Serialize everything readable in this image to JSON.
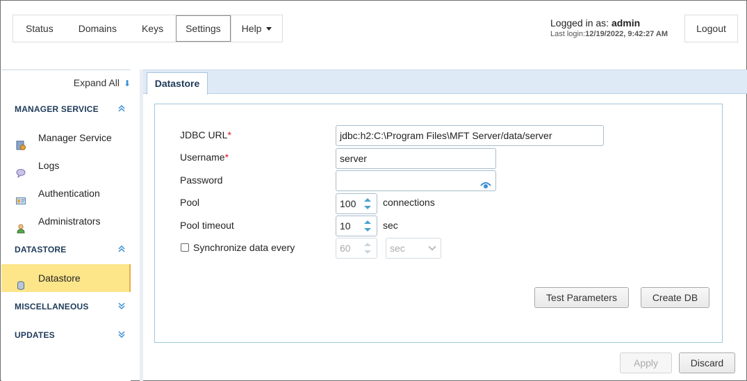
{
  "topnav": {
    "items": [
      "Status",
      "Domains",
      "Keys",
      "Settings",
      "Help"
    ],
    "active": "Settings"
  },
  "login": {
    "prefix": "Logged in as: ",
    "user": "admin",
    "last_prefix": "Last login:",
    "last_value": "12/19/2022, 9:42:27 AM"
  },
  "logout_label": "Logout",
  "sidebar": {
    "expand_all": "Expand All",
    "sections": {
      "manager": "MANAGER SERVICE",
      "datastore": "DATASTORE",
      "misc": "MISCELLANEOUS",
      "updates": "UPDATES"
    },
    "items": {
      "manager_service": "Manager Service",
      "logs": "Logs",
      "authentication": "Authentication",
      "administrators": "Administrators",
      "datastore": "Datastore"
    }
  },
  "tab_label": "Datastore",
  "form": {
    "jdbc_label": "JDBC URL",
    "jdbc_value": "jdbc:h2:C:\\Program Files\\MFT Server/data/server",
    "username_label": "Username",
    "username_value": "server",
    "password_label": "Password",
    "password_value": "",
    "pool_label": "Pool",
    "pool_value": "100",
    "pool_unit": "connections",
    "timeout_label": "Pool timeout",
    "timeout_value": "10",
    "timeout_unit": "sec",
    "sync_label": "Synchronize data every",
    "sync_checked": false,
    "sync_value": "60",
    "sync_unit_selected": "sec",
    "required_mark": "*"
  },
  "buttons": {
    "test": "Test Parameters",
    "create": "Create DB",
    "apply": "Apply",
    "discard": "Discard"
  },
  "colors": {
    "accent": "#3a8fd4",
    "selected_bg": "#fde68a",
    "header_bg": "#dfeaf7"
  }
}
